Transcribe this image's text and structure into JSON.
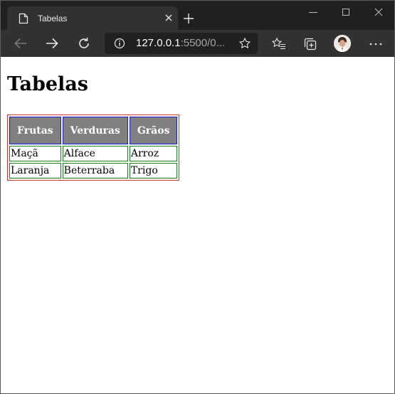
{
  "browser": {
    "tab_title": "Tabelas",
    "url_host": "127.0.0.1",
    "url_rest": ":5500/0..."
  },
  "page": {
    "heading": "Tabelas",
    "table": {
      "headers": [
        "Frutas",
        "Verduras",
        "Grãos"
      ],
      "rows": [
        [
          "Maçã",
          "Alface",
          "Arroz"
        ],
        [
          "Laranja",
          "Beterraba",
          "Trigo"
        ]
      ]
    }
  },
  "colors": {
    "tabstrip": "#202020",
    "toolbar": "#323232",
    "table_border": "#cc3333",
    "header_bg": "#808080",
    "header_border": "#1a1acc",
    "cell_border": "#1a7a1a"
  },
  "icons": [
    "page-icon",
    "close-icon",
    "plus-icon",
    "minimize-icon",
    "maximize-icon",
    "back-arrow-icon",
    "forward-arrow-icon",
    "reload-icon",
    "info-icon",
    "star-icon",
    "favorites-icon",
    "collections-icon",
    "more-icon"
  ]
}
